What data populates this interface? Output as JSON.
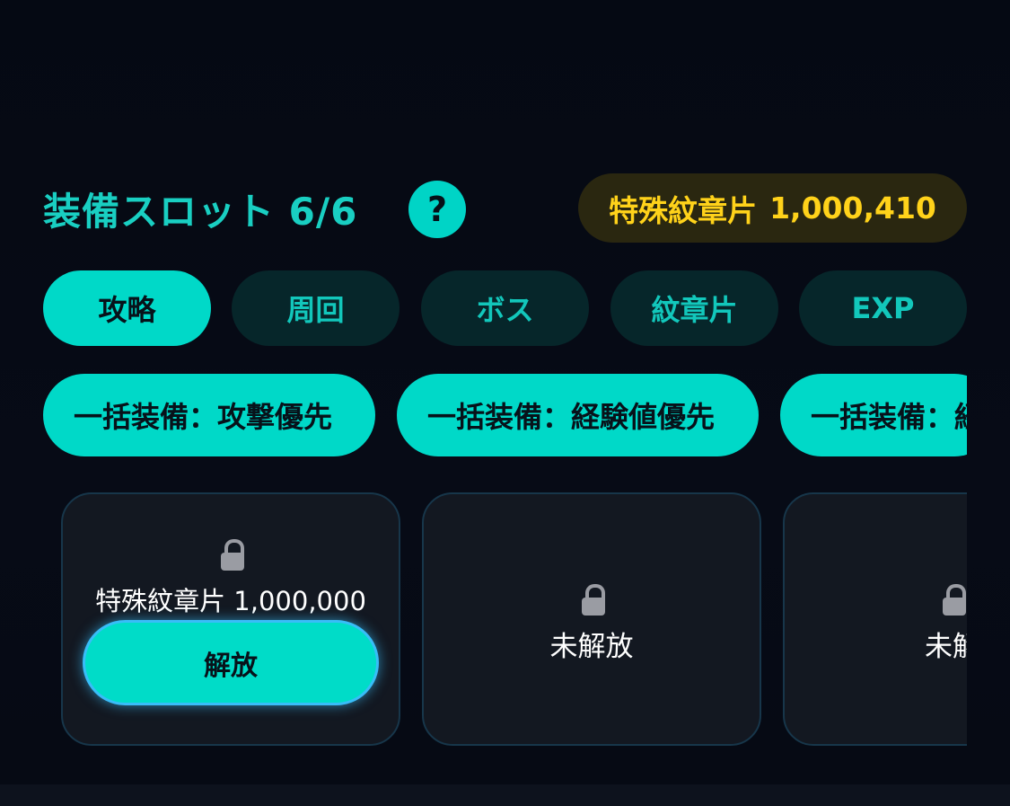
{
  "header": {
    "slot_title": "装備スロット 6/6",
    "help_label": "?",
    "currency_label": "特殊紋章片",
    "currency_value": "1,000,410"
  },
  "tabs": [
    {
      "label": "攻略",
      "active": true
    },
    {
      "label": "周回",
      "active": false
    },
    {
      "label": "ボス",
      "active": false
    },
    {
      "label": "紋章片",
      "active": false
    },
    {
      "label": "EXP",
      "active": false
    }
  ],
  "bulk_equip": [
    {
      "label": "一括装備：攻撃優先"
    },
    {
      "label": "一括装備：経験値優先"
    },
    {
      "label": "一括装備：経"
    }
  ],
  "slots": [
    {
      "cost_text": "特殊紋章片 1,000,000",
      "button_label": "解放"
    },
    {
      "status_text": "未解放"
    },
    {
      "status_text": "未解"
    }
  ],
  "colors": {
    "accent": "#00d9c8",
    "tab_inactive_bg": "#06262a",
    "currency_text": "#ffd21a",
    "currency_bg": "#2a2710",
    "background": "#060a14"
  }
}
